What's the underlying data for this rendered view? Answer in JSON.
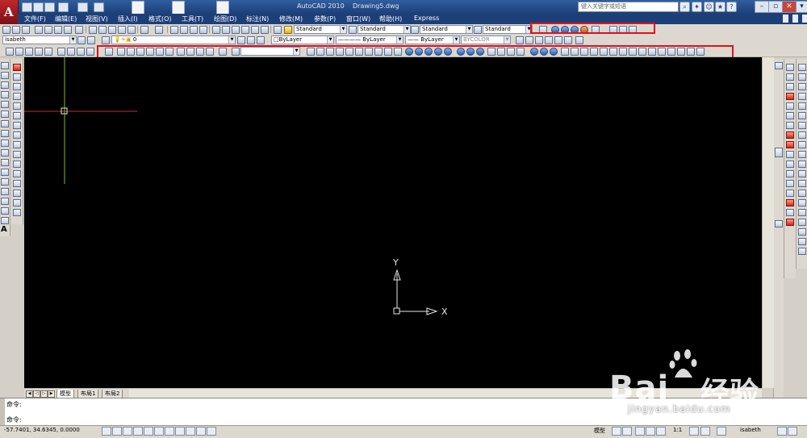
{
  "window": {
    "app_title": "AutoCAD 2010",
    "drawing_name": "Drawing5.dwg",
    "search_placeholder": "键入关键字或短语",
    "controls": [
      "minimize",
      "restore",
      "close"
    ]
  },
  "menu": {
    "items": [
      "文件(F)",
      "编辑(E)",
      "视图(V)",
      "插入(I)",
      "格式(O)",
      "工具(T)",
      "绘图(D)",
      "标注(N)",
      "修改(M)",
      "参数(P)",
      "窗口(W)",
      "帮助(H)",
      "Express"
    ]
  },
  "styles": {
    "text_style": "Standard",
    "dim_style": "Standard",
    "table_style": "Standard",
    "multileader_style": "Standard"
  },
  "layers": {
    "workspace_name": "isabeth",
    "current_layer": "0",
    "color": "ByLayer",
    "linetype": "ByLayer",
    "lineweight": "ByLayer",
    "plot_style": "BYCOLOR"
  },
  "drawing": {
    "background_color": "#000000",
    "ucs_x_label": "X",
    "ucs_y_label": "Y"
  },
  "layout_tabs": [
    "模型",
    "布局1",
    "布局2"
  ],
  "command": {
    "lines": [
      "命令:",
      "命令:"
    ]
  },
  "status": {
    "coordinates": "-57.7401, 34.6345, 0.0000",
    "model_label": "模型",
    "annotation_scale": "1:1",
    "workspace_user": "isabeth"
  },
  "watermark": {
    "brand": "Bai",
    "brand_cn": "经验",
    "url": "jingyan.baidu.com"
  },
  "highlight_color": "#e0101c"
}
